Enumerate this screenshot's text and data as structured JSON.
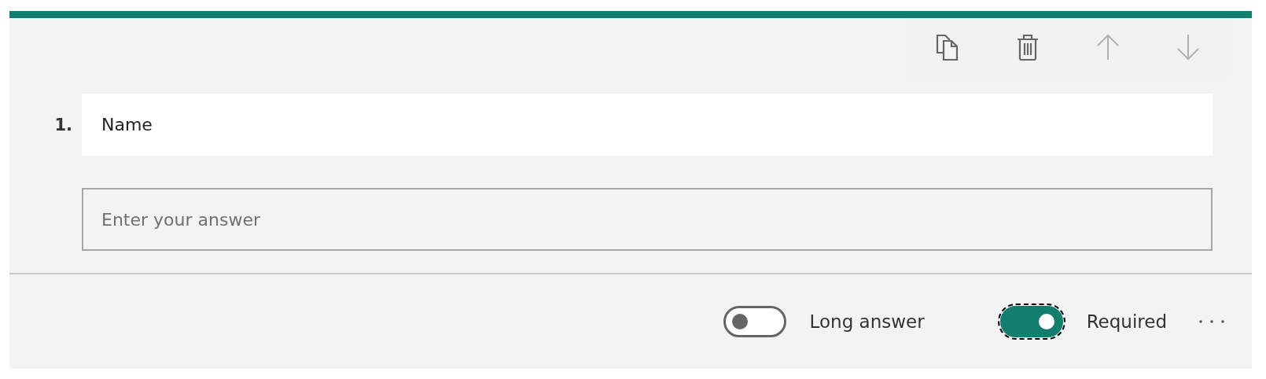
{
  "toolbar": [
    {
      "kind": "copy",
      "disabled": false
    },
    {
      "kind": "delete",
      "disabled": false
    },
    {
      "kind": "up",
      "disabled": true
    },
    {
      "kind": "down",
      "disabled": true
    }
  ],
  "question": {
    "number": "1.",
    "title": "Name",
    "answer": {
      "placeholder": "Enter your answer"
    }
  },
  "options": [
    {
      "label": "Long answer",
      "on": false,
      "focused": false
    },
    {
      "label": "Required",
      "on": true,
      "focused": true
    }
  ]
}
